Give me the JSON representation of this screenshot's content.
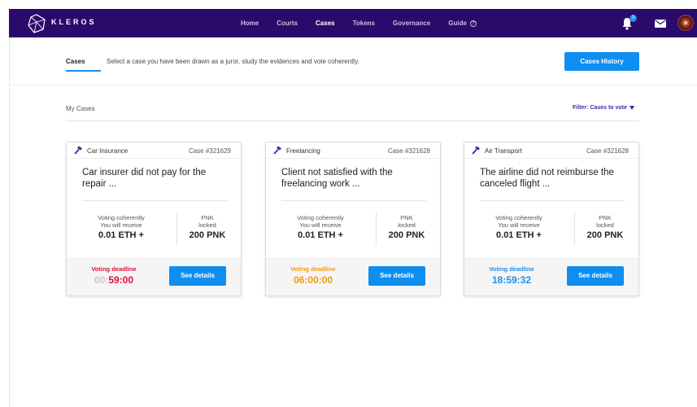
{
  "nav": {
    "brand": "KLEROS",
    "links": [
      {
        "label": "Home"
      },
      {
        "label": "Courts"
      },
      {
        "label": "Cases"
      },
      {
        "label": "Tokens"
      },
      {
        "label": "Governance"
      },
      {
        "label": "Guide"
      }
    ],
    "active": "Cases",
    "notification_count": "3",
    "colors": {
      "bar": "#2b0a6b",
      "accent": "#0f8ef0"
    }
  },
  "subheader": {
    "tab": "Cases",
    "description": "Select a case you have been drawn as a juror, study the evidences and vote coherently.",
    "history_button": "Cases History"
  },
  "section": {
    "title": "My Cases",
    "filter": "Filter: Cases to vote"
  },
  "cards": [
    {
      "court": "Car Insurance",
      "case_number": "Case #321629",
      "title": "Car insurer did not pay for the repair ...",
      "reward_label_1": "Voting coherently",
      "reward_label_2": "You will receive",
      "reward_value": "0.01 ETH +",
      "pnk_label_1": "PNK",
      "pnk_label_2": "locked",
      "pnk_value": "200 PNK",
      "deadline_label": "Voting deadline",
      "deadline_dim": "00:",
      "deadline_time": "59:00",
      "deadline_color": "#e0103a",
      "button": "See details"
    },
    {
      "court": "Freelancing",
      "case_number": "Case #321628",
      "title": "Client not satisfied with the freelancing work ...",
      "reward_label_1": "Voting coherently",
      "reward_label_2": "You will receive",
      "reward_value": "0.01 ETH +",
      "pnk_label_1": "PNK",
      "pnk_label_2": "locked",
      "pnk_value": "200 PNK",
      "deadline_label": "Voting deadline",
      "deadline_dim": "",
      "deadline_time": "06:00:00",
      "deadline_color": "#f39a12",
      "button": "See details"
    },
    {
      "court": "Air Transport",
      "case_number": "Case #321628",
      "title": "The airline did not reimburse the canceled flight ...",
      "reward_label_1": "Voting coherently",
      "reward_label_2": "You will receive",
      "reward_value": "0.01 ETH +",
      "pnk_label_1": "PNK",
      "pnk_label_2": "locked",
      "pnk_value": "200 PNK",
      "deadline_label": "Voting deadline",
      "deadline_dim": "",
      "deadline_time": "18:59:32",
      "deadline_color": "#1e8ef0",
      "button": "See details"
    }
  ]
}
